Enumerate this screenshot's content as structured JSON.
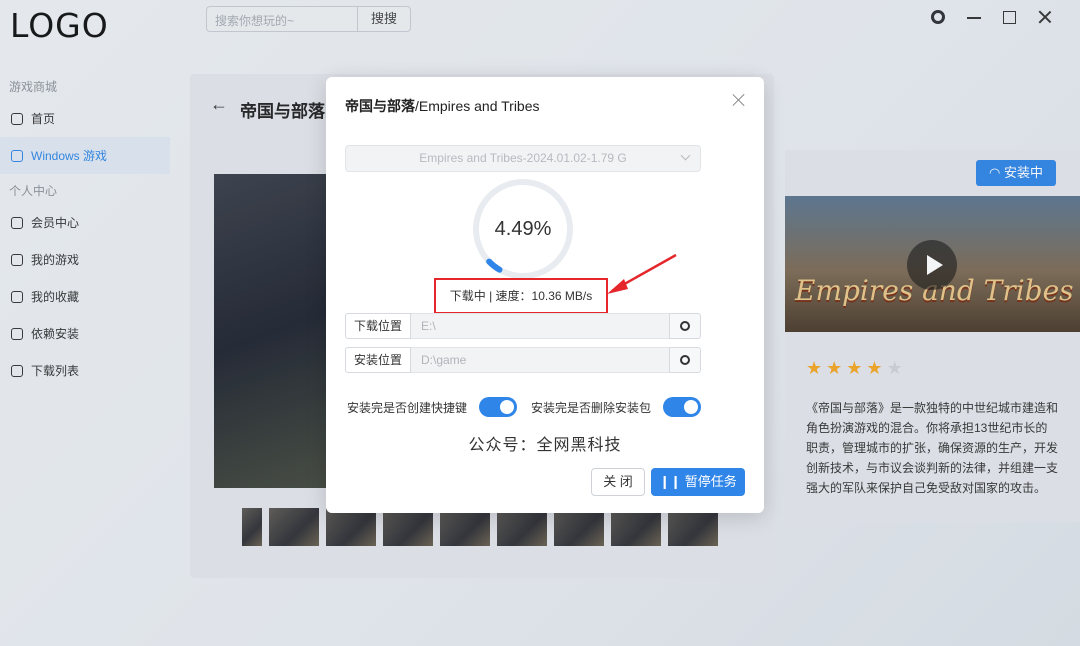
{
  "app": {
    "logo": "LOGO",
    "search_placeholder": "搜索你想玩的~",
    "search_button": "搜搜",
    "window_icons": [
      "gear-icon",
      "minimize-icon",
      "maximize-icon",
      "close-icon"
    ]
  },
  "sidebar": {
    "group_store": "游戏商城",
    "group_personal": "个人中心",
    "items": [
      {
        "label": "首页",
        "icon": "home-icon"
      },
      {
        "label": "Windows 游戏",
        "icon": "windows-icon",
        "active": true
      },
      {
        "label": "会员中心",
        "icon": "crown-icon"
      },
      {
        "label": "我的游戏",
        "icon": "user-icon"
      },
      {
        "label": "我的收藏",
        "icon": "heart-icon"
      },
      {
        "label": "依赖安装",
        "icon": "link-icon"
      },
      {
        "label": "下载列表",
        "icon": "clock-icon"
      }
    ]
  },
  "page": {
    "title": "帝国与部落",
    "install_badge": "安装中",
    "hero_title": "Empires and Tribes",
    "rating": 4,
    "rating_max": 5,
    "description": "《帝国与部落》是一款独特的中世纪城市建造和角色扮演游戏的混合。你将承担13世纪市长的职责，管理城市的扩张，确保资源的生产，开发创新技术，与市议会谈判新的法律，并组建一支强大的军队来保护自己免受敌对国家的攻击。"
  },
  "dialog": {
    "title_cn": "帝国与部落",
    "title_en": "/Empires and Tribes",
    "version_option": "Empires and Tribes-2024.01.02-1.79 G",
    "progress_percent": 4.49,
    "progress_text": "4.49%",
    "status_text": "下载中 | 速度：10.36 MB/s",
    "download_location_label": "下载位置",
    "download_location_value": "E:\\",
    "install_location_label": "安装位置",
    "install_location_value": "D:\\game",
    "toggle_shortcut_label": "安装完是否创建快捷键",
    "toggle_shortcut_on": true,
    "toggle_delete_label": "安装完是否删除安装包",
    "toggle_delete_on": true,
    "watermark": "公众号：全网黑科技",
    "close_button": "关 闭",
    "pause_button": "暂停任务",
    "accent_color": "#2f86e8",
    "highlight_color": "#e5262a"
  }
}
